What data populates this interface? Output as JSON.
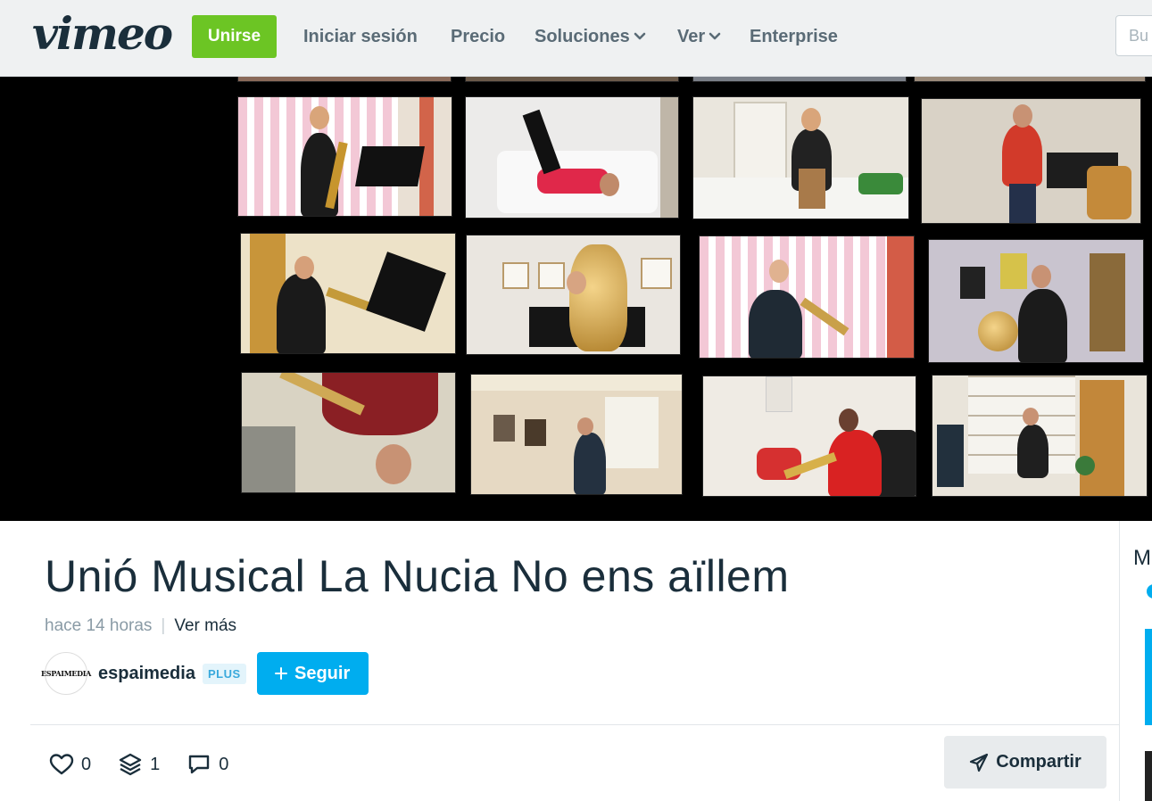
{
  "header": {
    "logo": "vimeo",
    "join_label": "Unirse",
    "nav": [
      {
        "label": "Iniciar sesión",
        "dropdown": false
      },
      {
        "label": "Precio",
        "dropdown": false
      },
      {
        "label": "Soluciones",
        "dropdown": true
      },
      {
        "label": "Ver",
        "dropdown": true
      },
      {
        "label": "Enterprise",
        "dropdown": false
      }
    ],
    "search_placeholder": "Bu"
  },
  "video": {
    "description": "grid of 12 musicians playing instruments at home"
  },
  "clip": {
    "title": "Unió Musical La Nucia No ens aïllem",
    "age": "hace 14 horas",
    "more_label": "Ver más"
  },
  "channel": {
    "avatar_text": "ESPAIMEDIA",
    "name": "espaimedia",
    "badge": "PLUS",
    "follow_label": "Seguir"
  },
  "stats": {
    "likes": "0",
    "collections": "1",
    "comments": "0"
  },
  "share_label": "Compartir",
  "sidebar": {
    "heading_fragment": "M"
  },
  "colors": {
    "brand_green": "#6cc524",
    "accent_blue": "#00adef",
    "text_dark": "#1a2e3b"
  }
}
